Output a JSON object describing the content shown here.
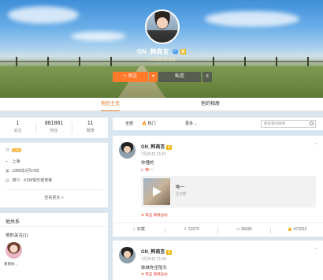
{
  "profile": {
    "name": "GN_韩商言",
    "badge": "会",
    "verify": "KSM俱乐部老板",
    "follow_label": "+ 关注",
    "message_label": "私信"
  },
  "tabs": {
    "home": "他的主页",
    "album": "他的相册"
  },
  "stats": [
    {
      "value": "1",
      "label": "关注"
    },
    {
      "value": "881881",
      "label": "粉丝"
    },
    {
      "value": "11",
      "label": "微博"
    }
  ],
  "info": {
    "level_prefix": "日",
    "level": "Lv6",
    "location": "上海",
    "birthday": "1989年2月14日",
    "bio_label": "简介：",
    "bio": "KSM俱乐部老板",
    "see_more": "查看更多 >"
  },
  "follows": {
    "title": "他关系",
    "subtitle": "他的关注(1)",
    "item_name": "黄墨妍..."
  },
  "filters": {
    "all": "全部",
    "hot": "🔥 热门",
    "more": "更多 ⌄",
    "search_placeholder": "搜索我的微博"
  },
  "posts": [
    {
      "name": "GN_韩商言",
      "badge": "会",
      "time": "7月26日 21:57",
      "text": "你懂的",
      "music_tag": "▷ 唯一",
      "music_title": "唯一",
      "music_artist": "王力宏",
      "source": "来自 微博运动",
      "actions": {
        "fav": "收藏",
        "repost": "21579",
        "comment": "35660",
        "like": "473253"
      }
    },
    {
      "name": "GN_韩商言",
      "badge": "会",
      "time": "7月24日 21:35",
      "text": "妹妹你坐船头",
      "source": "来自 微博运动"
    }
  ]
}
